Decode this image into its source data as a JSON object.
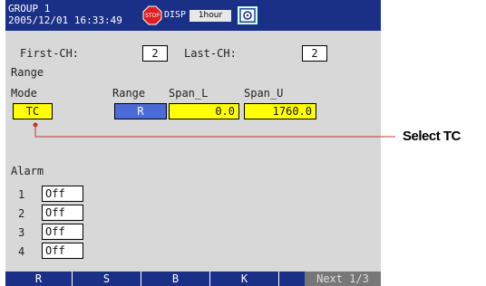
{
  "header": {
    "group": "GROUP 1",
    "datetime": "2005/12/01 16:33:49",
    "disp_label": "DISP",
    "interval": "1hour",
    "stop_icon": "stop-icon",
    "monitor_icon": "monitor-icon"
  },
  "channels": {
    "first_label": "First-CH:",
    "first_value": "2",
    "last_label": "Last-CH:",
    "last_value": "2"
  },
  "range": {
    "section_label": "Range",
    "mode_label": "Mode",
    "mode_value": "TC",
    "range_label": "Range",
    "range_value": "R",
    "span_l_label": "Span_L",
    "span_l_value": "0.0",
    "span_u_label": "Span_U",
    "span_u_value": "1760.0"
  },
  "alarm": {
    "label": "Alarm",
    "rows": [
      {
        "num": "1",
        "value": "Off"
      },
      {
        "num": "2",
        "value": "Off"
      },
      {
        "num": "3",
        "value": "Off"
      },
      {
        "num": "4",
        "value": "Off"
      }
    ]
  },
  "softkeys": [
    "R",
    "S",
    "B",
    "K"
  ],
  "softkey_next": "Next 1/3",
  "callout": "Select TC",
  "colors": {
    "header_bg": "#1a2f86",
    "screen_bg": "#d8d8d8",
    "highlight": "#ffff00",
    "selected": "#4a6bd8",
    "callout_line": "#c0392b"
  }
}
